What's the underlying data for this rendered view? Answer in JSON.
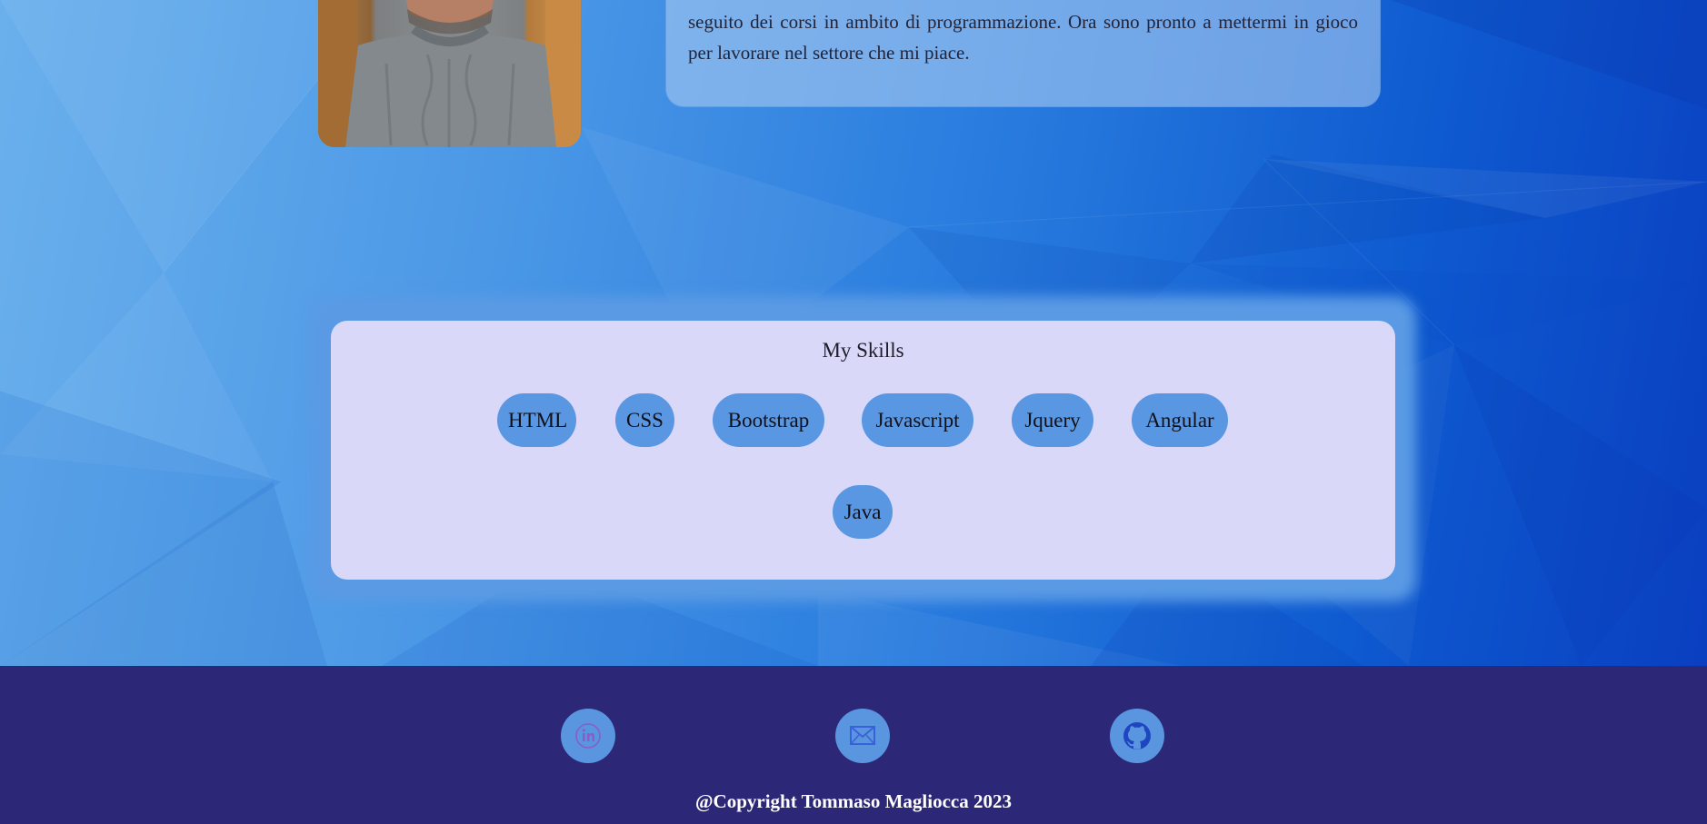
{
  "about": {
    "text": "seguito dei corsi in ambito di programmazione. Ora sono pronto a mettermi in gioco per lavorare nel settore che mi piace."
  },
  "skills": {
    "title": "My Skills",
    "items": [
      "HTML",
      "CSS",
      "Bootstrap",
      "Javascript",
      "Jquery",
      "Angular",
      "Java"
    ]
  },
  "footer": {
    "social": [
      {
        "name": "linkedin-icon"
      },
      {
        "name": "mail-icon"
      },
      {
        "name": "github-icon"
      }
    ],
    "copyright": "@Copyright Tommaso Magliocca 2023"
  },
  "colors": {
    "footer_bg": "#2c2877",
    "skill_pill": "#5a97e2",
    "skills_card": "#d9d8f8",
    "hero_light": "#6ab0ec",
    "hero_dark": "#0a3fc0"
  }
}
